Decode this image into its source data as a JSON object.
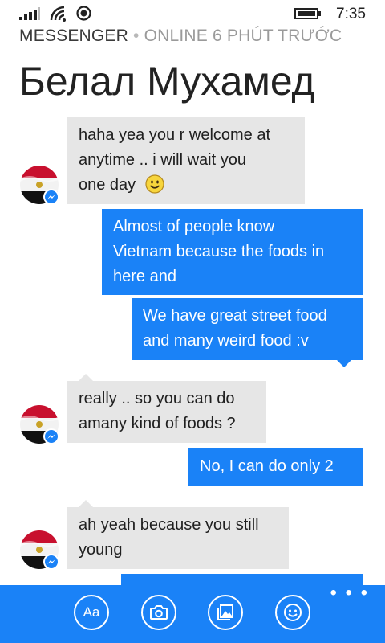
{
  "status_bar": {
    "time": "7:35",
    "icons": [
      "signal-icon",
      "wifi-icon",
      "location-icon",
      "battery-icon"
    ]
  },
  "header": {
    "app_name": "MESSENGER",
    "separator": "•",
    "presence": "ONLINE 6 PHÚT TRƯỚC",
    "contact_name": "Белал Мухамед"
  },
  "messages": [
    {
      "direction": "in",
      "lines": [
        "haha yea you r welcome at",
        "anytime .. i will wait you"
      ],
      "last_line": "one day",
      "emoji": "smile-emoji"
    },
    {
      "direction": "out",
      "lines": [
        "Almost of people know",
        "Vietnam because the foods in",
        "here and"
      ]
    },
    {
      "direction": "out",
      "lines": [
        "We have great street food",
        "and many weird food :v"
      ]
    },
    {
      "direction": "in",
      "lines": [
        "really .. so you can do",
        "amany kind of foods ?"
      ]
    },
    {
      "direction": "out",
      "lines": [
        "No, I can do only 2"
      ]
    },
    {
      "direction": "in",
      "lines": [
        "ah yeah because you still",
        "young"
      ]
    }
  ],
  "app_bar": {
    "more": "• • •",
    "buttons": [
      {
        "name": "text-format-button",
        "label": "Aa"
      },
      {
        "name": "camera-button",
        "icon": "camera-icon"
      },
      {
        "name": "photos-button",
        "icon": "photos-icon"
      },
      {
        "name": "emoji-button",
        "icon": "smiley-icon"
      }
    ]
  },
  "colors": {
    "accent": "#1a82f7",
    "incoming_bubble": "#e6e6e6",
    "background": "#ffffff"
  }
}
